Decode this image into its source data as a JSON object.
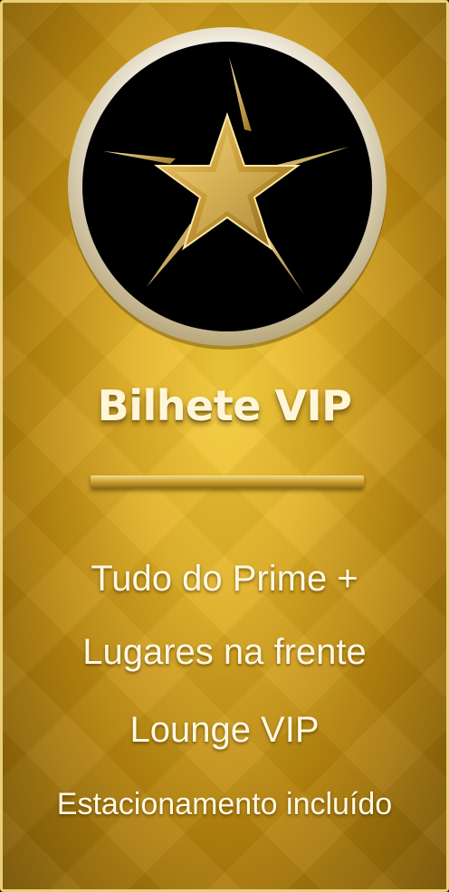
{
  "card": {
    "title": "Bilhete VIP",
    "features": [
      "Tudo do Prime +",
      "Lugares na frente",
      "Lounge VIP",
      "Estacionamento incluído"
    ]
  },
  "emblem": {
    "icon": "star-icon"
  },
  "colors": {
    "gold_light": "#f7cf3b",
    "gold_dark": "#7d5806",
    "border": "#e9cf78",
    "text": "#fff8e2",
    "emblem_background": "#000000"
  }
}
